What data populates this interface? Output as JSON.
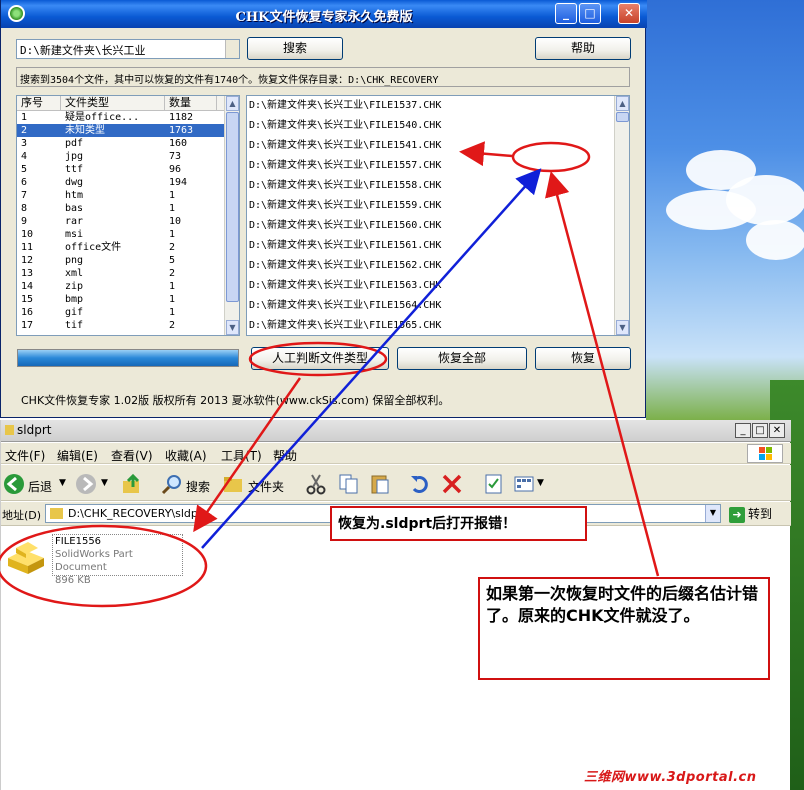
{
  "app_window": {
    "title": "CHK文件恢复专家永久免费版",
    "path_value": "D:\\新建文件夹\\长兴工业",
    "search_button": "搜索",
    "help_button": "帮助",
    "status_text": "搜索到3504个文件，其中可以恢复的文件有1740个。恢复文件保存目录：D:\\CHK_RECOVERY",
    "type_table": {
      "headers": [
        "序号",
        "文件类型",
        "数量"
      ],
      "rows": [
        [
          "1",
          "疑是office...",
          "1182"
        ],
        [
          "2",
          "未知类型",
          "1763"
        ],
        [
          "3",
          "pdf",
          "160"
        ],
        [
          "4",
          "jpg",
          "73"
        ],
        [
          "5",
          "ttf",
          "96"
        ],
        [
          "6",
          "dwg",
          "194"
        ],
        [
          "7",
          "htm",
          "1"
        ],
        [
          "8",
          "bas",
          "1"
        ],
        [
          "9",
          "rar",
          "10"
        ],
        [
          "10",
          "msi",
          "1"
        ],
        [
          "11",
          "office文件",
          "2"
        ],
        [
          "12",
          "png",
          "5"
        ],
        [
          "13",
          "xml",
          "2"
        ],
        [
          "14",
          "zip",
          "1"
        ],
        [
          "15",
          "bmp",
          "1"
        ],
        [
          "16",
          "gif",
          "1"
        ],
        [
          "17",
          "tif",
          "2"
        ]
      ],
      "selected_index": 1
    },
    "files": [
      "D:\\新建文件夹\\长兴工业\\FILE1537.CHK",
      "D:\\新建文件夹\\长兴工业\\FILE1540.CHK",
      "D:\\新建文件夹\\长兴工业\\FILE1541.CHK",
      "D:\\新建文件夹\\长兴工业\\FILE1557.CHK",
      "D:\\新建文件夹\\长兴工业\\FILE1558.CHK",
      "D:\\新建文件夹\\长兴工业\\FILE1559.CHK",
      "D:\\新建文件夹\\长兴工业\\FILE1560.CHK",
      "D:\\新建文件夹\\长兴工业\\FILE1561.CHK",
      "D:\\新建文件夹\\长兴工业\\FILE1562.CHK",
      "D:\\新建文件夹\\长兴工业\\FILE1563.CHK",
      "D:\\新建文件夹\\长兴工业\\FILE1564.CHK",
      "D:\\新建文件夹\\长兴工业\\FILE1565.CHK"
    ],
    "buttons": {
      "manual_type": "人工判断文件类型",
      "restore_all": "恢复全部",
      "restore": "恢复"
    },
    "footer": "CHK文件恢复专家 1.02版   版权所有 2013 夏冰软件(www.ckSis.com) 保留全部权利。"
  },
  "explorer": {
    "title": "sldprt",
    "menu": [
      "文件(F)",
      "编辑(E)",
      "查看(V)",
      "收藏(A)",
      "工具(T)",
      "帮助"
    ],
    "toolbar": {
      "back": "后退",
      "search": "搜索",
      "folders": "文件夹"
    },
    "address_label": "地址(D)",
    "address_value": "D:\\CHK_RECOVERY\\sldprt",
    "go_label": "转到",
    "file": {
      "name": "FILE1556",
      "type": "SolidWorks Part Document",
      "size": "896 KB"
    }
  },
  "annotations": {
    "note1": "恢复为.sldprt后打开报错！",
    "note2": "如果第一次恢复时文件的后缀名估计错了。原来的CHK文件就没了。",
    "accent": "#d01010"
  },
  "watermark": "三维网www.3dportal.cn"
}
